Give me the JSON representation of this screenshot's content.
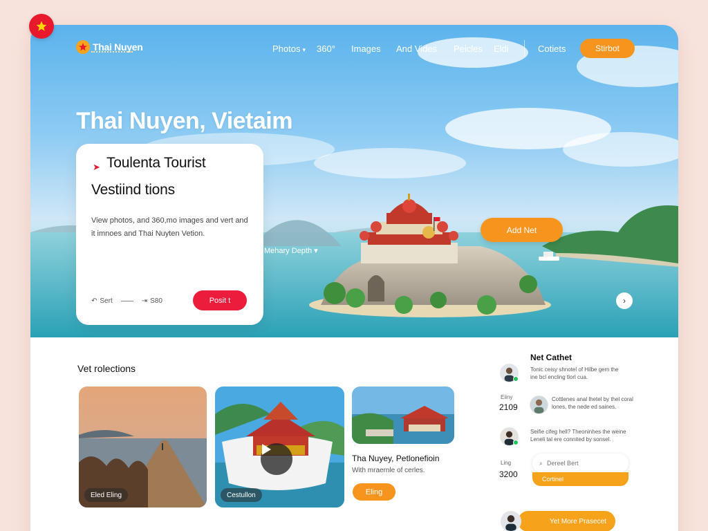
{
  "brand": {
    "name": "Thai Nuyen"
  },
  "nav": {
    "items": [
      {
        "label": "Photos",
        "dropdown": true
      },
      {
        "label": "360°"
      },
      {
        "label": "Images"
      },
      {
        "label": "And Vides"
      },
      {
        "label": "Peicles"
      },
      {
        "label": "Eldi"
      },
      {
        "label": "Cotiets"
      }
    ],
    "cta": "Stirbot"
  },
  "hero": {
    "title": "Thai Nuyen, Vietaim",
    "card": {
      "heading_line1": "Toulenta Tourist",
      "heading_line2": "Vestiind tions",
      "description": "View photos, and 360,mo images and vert and it imnoes and Thai Nuyten Vetion.",
      "prev_label": "Sert",
      "next_label": "S80",
      "button": "Posit t"
    },
    "dropdown": "Mehary Depth",
    "add_button": "Add Net"
  },
  "collections": {
    "title": "Vet rolections",
    "cards": [
      {
        "label": "Eled Eling"
      },
      {
        "label": "Cestullon"
      },
      {
        "title": "Tha Nuyey, Petlonefioin",
        "subtitle": "With mraernle of cerles.",
        "button": "Eling"
      }
    ]
  },
  "sidebar": {
    "title": "Net Cathet",
    "comments": [
      {
        "text": "Tonic ceisy shnotel of Hilbe gem the ine bcl encling tlorl cua."
      },
      {
        "text": "Cottlenes anal lhetel by thel coral lones, the nede ed saines."
      },
      {
        "text": "Seifie cifeg hell? Theoninhes the weine Leneli tal ere connited by sonsel."
      }
    ],
    "stats": [
      {
        "label": "Eiiny",
        "value": "2109"
      },
      {
        "label": "Ling",
        "value": "3200"
      }
    ],
    "search_placeholder": "Dereel Bert",
    "search_action": "Cortinel",
    "bottom_cta": "Yet More Prasecet"
  },
  "colors": {
    "accent_orange": "#f7941d",
    "accent_red": "#ec1c3c",
    "sky_blue": "#5bb3ec",
    "background": "#f8e3dc"
  }
}
